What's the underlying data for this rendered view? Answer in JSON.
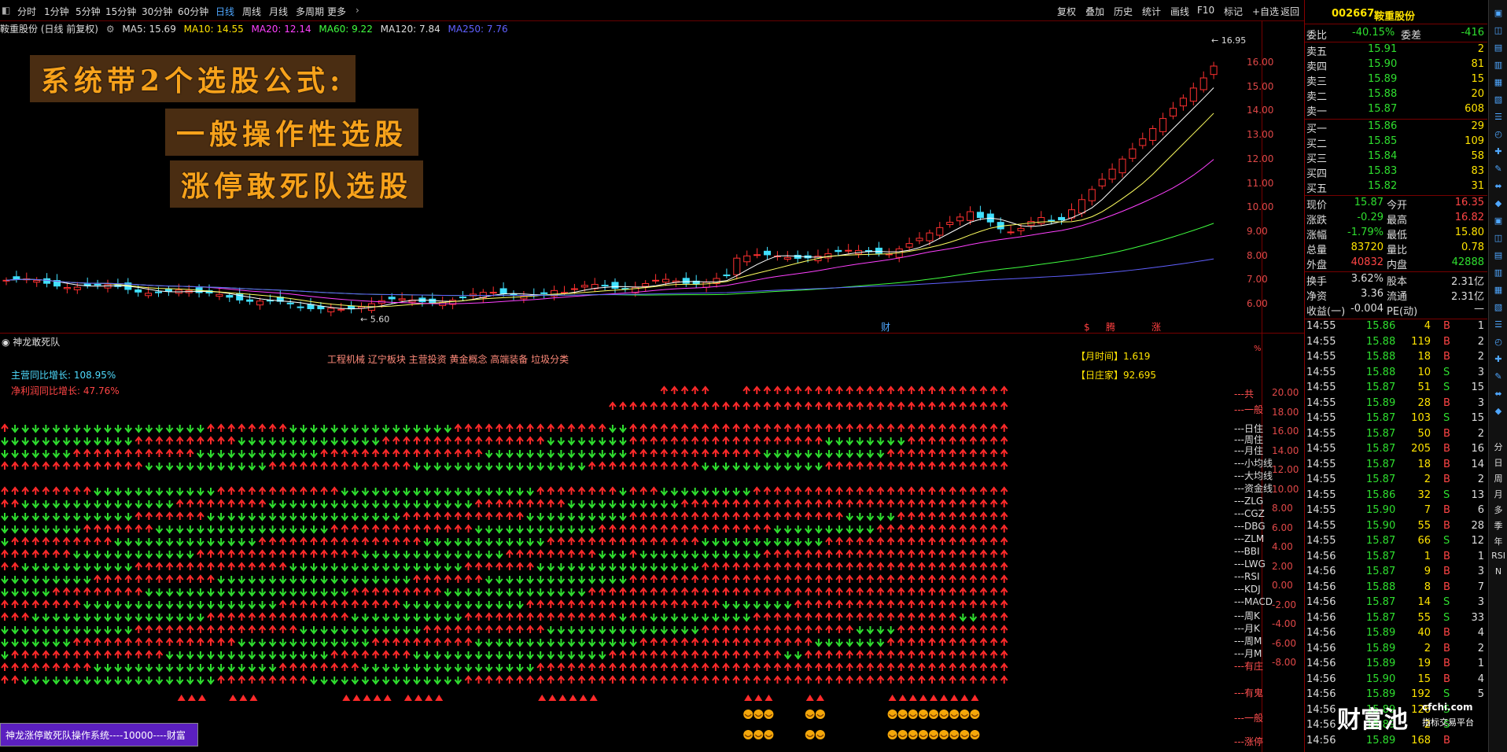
{
  "toolbar": {
    "periods": [
      "分时",
      "1分钟",
      "5分钟",
      "15分钟",
      "30分钟",
      "60分钟",
      "日线",
      "周线",
      "月线",
      "多周期",
      "更多"
    ],
    "active_period": "日线",
    "right_buttons": [
      "复权",
      "叠加",
      "历史",
      "统计",
      "画线",
      "F10",
      "标记",
      "+自选",
      "返回"
    ]
  },
  "ma_line": {
    "stock": "鞍重股份 (日线 前复权)",
    "ma5": "MA5: 15.69",
    "ma10": "MA10: 14.55",
    "ma20": "MA20: 12.14",
    "ma60": "MA60: 9.22",
    "ma120": "MA120: 7.84",
    "ma250": "MA250: 7.76"
  },
  "banners": {
    "line1": "系统带2个选股公式:",
    "line2": "一般操作性选股",
    "line3": "涨停敢死队选股"
  },
  "price_chart": {
    "high_label": "16.95",
    "low_label": "5.60",
    "axis_ticks": [
      "16.00",
      "15.00",
      "14.00",
      "13.00",
      "12.00",
      "11.00",
      "10.00",
      "9.00",
      "8.00",
      "7.00",
      "6.00"
    ],
    "markers": [
      "财",
      "$",
      "腾",
      "涨"
    ],
    "colors": {
      "up": "#ff3030",
      "down": "#40e0ff",
      "ma5": "#ffffff",
      "ma10": "#ffff60",
      "ma20": "#ff40ff",
      "ma60": "#40ff40",
      "ma120": "#6060ff"
    }
  },
  "indicator_panel": {
    "title": "神龙敢死队",
    "sectors": "工程机械 辽宁板块 主营投资 黄金概念 高端装备 垃圾分类",
    "revenue_growth": "主营同比增长: 108.95%",
    "profit_growth": "净利润同比增长: 47.76%",
    "month_time": "【月时间】1.619",
    "day_banker": "【日庄家】92.695",
    "axis_ticks": [
      "20.00",
      "18.00",
      "16.00",
      "14.00",
      "12.00",
      "10.00",
      "8.00",
      "6.00",
      "4.00",
      "2.00",
      "0.00",
      "-2.00",
      "-4.00",
      "-6.00",
      "-8.00"
    ],
    "row_labels": [
      "共",
      "一般",
      "日住",
      "周住",
      "月住",
      "小均线",
      "大均线",
      "资金线",
      "ZLG",
      "CGZ",
      "DBG",
      "ZLM",
      "BBI",
      "LWG",
      "RSI",
      "KDJ",
      "MACD",
      "周K",
      "月K",
      "周M",
      "月M",
      "有庄",
      "有鬼",
      "一般",
      "涨停",
      "涨停"
    ],
    "footer_text": "神龙涨停敢死队操作系统----10000----财富",
    "pct_label": "%"
  },
  "quote": {
    "code": "002667",
    "name": "鞍重股份",
    "weibi_label": "委比",
    "weibi": "-40.15%",
    "weicha_label": "委差",
    "weicha": "-416",
    "sells": [
      {
        "label": "卖五",
        "price": "15.91",
        "vol": "2"
      },
      {
        "label": "卖四",
        "price": "15.90",
        "vol": "81"
      },
      {
        "label": "卖三",
        "price": "15.89",
        "vol": "15"
      },
      {
        "label": "卖二",
        "price": "15.88",
        "vol": "20"
      },
      {
        "label": "卖一",
        "price": "15.87",
        "vol": "608"
      }
    ],
    "buys": [
      {
        "label": "买一",
        "price": "15.86",
        "vol": "29"
      },
      {
        "label": "买二",
        "price": "15.85",
        "vol": "109"
      },
      {
        "label": "买三",
        "price": "15.84",
        "vol": "58"
      },
      {
        "label": "买四",
        "price": "15.83",
        "vol": "83"
      },
      {
        "label": "买五",
        "price": "15.82",
        "vol": "31"
      }
    ],
    "stats": [
      {
        "l1": "现价",
        "v1": "15.87",
        "l2": "今开",
        "v2": "16.35"
      },
      {
        "l1": "涨跌",
        "v1": "-0.29",
        "l2": "最高",
        "v2": "16.82"
      },
      {
        "l1": "涨幅",
        "v1": "-1.79%",
        "l2": "最低",
        "v2": "15.80"
      },
      {
        "l1": "总量",
        "v1": "83720",
        "l2": "量比",
        "v2": "0.78"
      },
      {
        "l1": "外盘",
        "v1": "40832",
        "l2": "内盘",
        "v2": "42888"
      }
    ],
    "stats2": [
      {
        "l1": "换手",
        "v1": "3.62%",
        "l2": "股本",
        "v2": "2.31亿"
      },
      {
        "l1": "净资",
        "v1": "3.36",
        "l2": "流通",
        "v2": "2.31亿"
      },
      {
        "l1": "收益(一)",
        "v1": "-0.004",
        "l2": "PE(动)",
        "v2": "—"
      }
    ],
    "ticks": [
      {
        "t": "14:55",
        "p": "15.86",
        "v": "4",
        "bs": "B",
        "n": "1"
      },
      {
        "t": "14:55",
        "p": "15.88",
        "v": "119",
        "bs": "B",
        "n": "2"
      },
      {
        "t": "14:55",
        "p": "15.88",
        "v": "18",
        "bs": "B",
        "n": "2"
      },
      {
        "t": "14:55",
        "p": "15.88",
        "v": "10",
        "bs": "S",
        "n": "3"
      },
      {
        "t": "14:55",
        "p": "15.87",
        "v": "51",
        "bs": "S",
        "n": "15"
      },
      {
        "t": "14:55",
        "p": "15.89",
        "v": "28",
        "bs": "B",
        "n": "3"
      },
      {
        "t": "14:55",
        "p": "15.87",
        "v": "103",
        "bs": "S",
        "n": "15"
      },
      {
        "t": "14:55",
        "p": "15.87",
        "v": "50",
        "bs": "B",
        "n": "2"
      },
      {
        "t": "14:55",
        "p": "15.87",
        "v": "205",
        "bs": "B",
        "n": "16"
      },
      {
        "t": "14:55",
        "p": "15.87",
        "v": "18",
        "bs": "B",
        "n": "14"
      },
      {
        "t": "14:55",
        "p": "15.87",
        "v": "2",
        "bs": "B",
        "n": "2"
      },
      {
        "t": "14:55",
        "p": "15.86",
        "v": "32",
        "bs": "S",
        "n": "13"
      },
      {
        "t": "14:55",
        "p": "15.90",
        "v": "7",
        "bs": "B",
        "n": "6"
      },
      {
        "t": "14:55",
        "p": "15.90",
        "v": "55",
        "bs": "B",
        "n": "28"
      },
      {
        "t": "14:55",
        "p": "15.87",
        "v": "66",
        "bs": "S",
        "n": "12"
      },
      {
        "t": "14:56",
        "p": "15.87",
        "v": "1",
        "bs": "B",
        "n": "1"
      },
      {
        "t": "14:56",
        "p": "15.87",
        "v": "9",
        "bs": "B",
        "n": "3"
      },
      {
        "t": "14:56",
        "p": "15.88",
        "v": "8",
        "bs": "B",
        "n": "7"
      },
      {
        "t": "14:56",
        "p": "15.87",
        "v": "14",
        "bs": "S",
        "n": "3"
      },
      {
        "t": "14:56",
        "p": "15.87",
        "v": "55",
        "bs": "S",
        "n": "33"
      },
      {
        "t": "14:56",
        "p": "15.89",
        "v": "40",
        "bs": "B",
        "n": "4"
      },
      {
        "t": "14:56",
        "p": "15.89",
        "v": "2",
        "bs": "B",
        "n": "2"
      },
      {
        "t": "14:56",
        "p": "15.89",
        "v": "19",
        "bs": "B",
        "n": "1"
      },
      {
        "t": "14:56",
        "p": "15.90",
        "v": "15",
        "bs": "B",
        "n": "4"
      },
      {
        "t": "14:56",
        "p": "15.89",
        "v": "192",
        "bs": "S",
        "n": "5"
      },
      {
        "t": "14:56",
        "p": "15.89",
        "v": "126",
        "bs": "S",
        "n": ""
      },
      {
        "t": "14:56",
        "p": "15.89",
        "v": "2",
        "bs": "S",
        "n": ""
      },
      {
        "t": "14:56",
        "p": "15.89",
        "v": "168",
        "bs": "B",
        "n": ""
      }
    ]
  },
  "side_icons": [
    "分",
    "日",
    "周",
    "月",
    "多",
    "季",
    "年",
    "RSI",
    "N"
  ],
  "watermark": {
    "brand": "财富池",
    "domain": "cfchi.com",
    "slogan": "指标交易平台"
  }
}
